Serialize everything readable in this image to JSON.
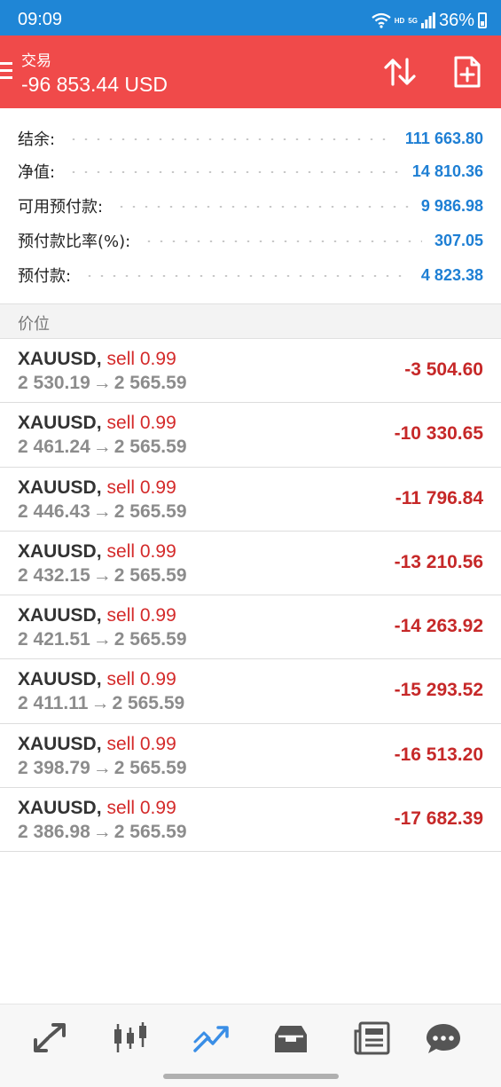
{
  "status_bar": {
    "time": "09:09",
    "network": "HD",
    "signal": "5G",
    "battery": "36%"
  },
  "header": {
    "title": "交易",
    "amount": "-96 853.44 USD",
    "icons": [
      "menu-icon",
      "sort-icon",
      "new-order-icon"
    ]
  },
  "summary": [
    {
      "label": "结余:",
      "value": "111 663.80"
    },
    {
      "label": "净值:",
      "value": "14 810.36"
    },
    {
      "label": "可用预付款:",
      "value": "9 986.98"
    },
    {
      "label": "预付款比率(%):",
      "value": "307.05"
    },
    {
      "label": "预付款:",
      "value": "4 823.38"
    }
  ],
  "section": {
    "title": "价位"
  },
  "trades": [
    {
      "symbol": "XAUUSD",
      "side": "sell 0.99",
      "open": "2 530.19",
      "current": "2 565.59",
      "profit": "-3 504.60"
    },
    {
      "symbol": "XAUUSD",
      "side": "sell 0.99",
      "open": "2 461.24",
      "current": "2 565.59",
      "profit": "-10 330.65"
    },
    {
      "symbol": "XAUUSD",
      "side": "sell 0.99",
      "open": "2 446.43",
      "current": "2 565.59",
      "profit": "-11 796.84"
    },
    {
      "symbol": "XAUUSD",
      "side": "sell 0.99",
      "open": "2 432.15",
      "current": "2 565.59",
      "profit": "-13 210.56"
    },
    {
      "symbol": "XAUUSD",
      "side": "sell 0.99",
      "open": "2 421.51",
      "current": "2 565.59",
      "profit": "-14 263.92"
    },
    {
      "symbol": "XAUUSD",
      "side": "sell 0.99",
      "open": "2 411.11",
      "current": "2 565.59",
      "profit": "-15 293.52"
    },
    {
      "symbol": "XAUUSD",
      "side": "sell 0.99",
      "open": "2 398.79",
      "current": "2 565.59",
      "profit": "-16 513.20"
    },
    {
      "symbol": "XAUUSD",
      "side": "sell 0.99",
      "open": "2 386.98",
      "current": "2 565.59",
      "profit": "-17 682.39"
    }
  ],
  "bottom_nav": {
    "items": [
      "quotes-icon",
      "chart-icon",
      "trade-icon",
      "history-icon",
      "news-icon",
      "messages-icon"
    ],
    "active": "trade-icon"
  },
  "colors": {
    "status_bar": "#1f86d6",
    "header": "#f04a4a",
    "value_blue": "#1e7fd4",
    "loss_red": "#c62828",
    "sell_red": "#d42a2a",
    "nav_active": "#3a8ee6"
  }
}
